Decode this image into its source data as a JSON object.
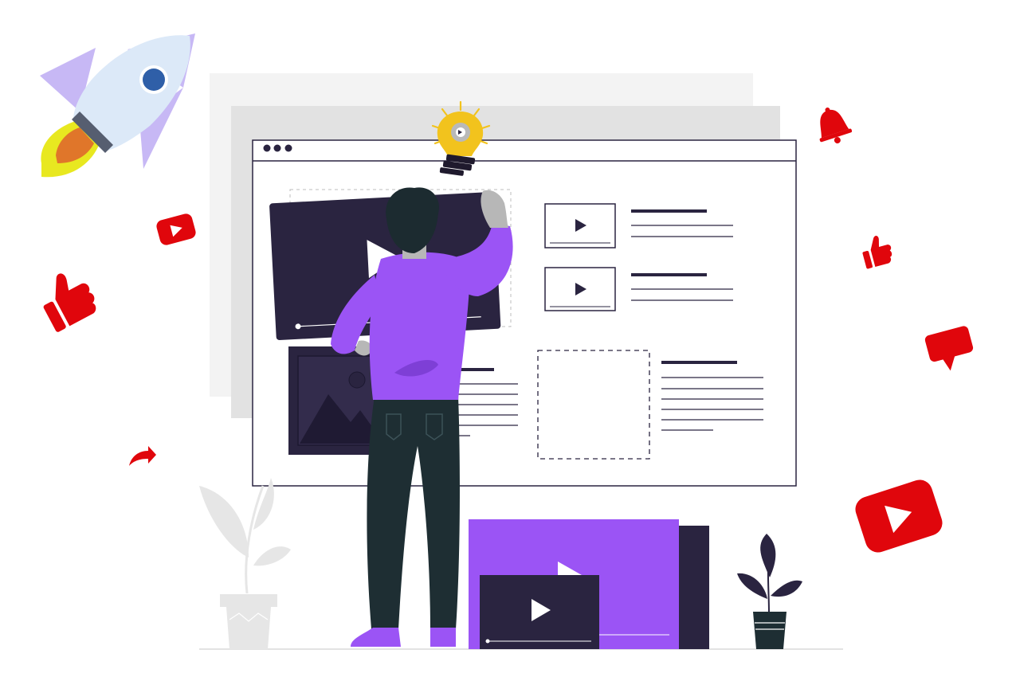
{
  "colors": {
    "background": "#ffffff",
    "panel_back": "#f3f3f3",
    "panel_mid": "#e2e2e2",
    "window_border": "#2a2440",
    "dark": "#2a2440",
    "purple": "#9b54f5",
    "red": "#e0060c",
    "rocket_body": "#dce9f8",
    "rocket_fin": "#c7b8f5",
    "rocket_window": "#2f5fa8",
    "flame_yellow": "#e8e820",
    "flame_orange": "#e0762a",
    "bulb": "#f2c31d",
    "plant_grey": "#e6e6e6",
    "pants": "#1e2e33",
    "hair": "#1c2b30",
    "skin": "#b7b7b7"
  },
  "icons": [
    "rocket-icon",
    "lightbulb-gear-icon",
    "bell-icon",
    "youtube-play-icon",
    "thumbs-up-icon",
    "speech-bubble-icon",
    "share-arrow-icon",
    "window-dots-icon",
    "play-icon"
  ],
  "scene": {
    "figure": "person-arranging-video-page"
  }
}
